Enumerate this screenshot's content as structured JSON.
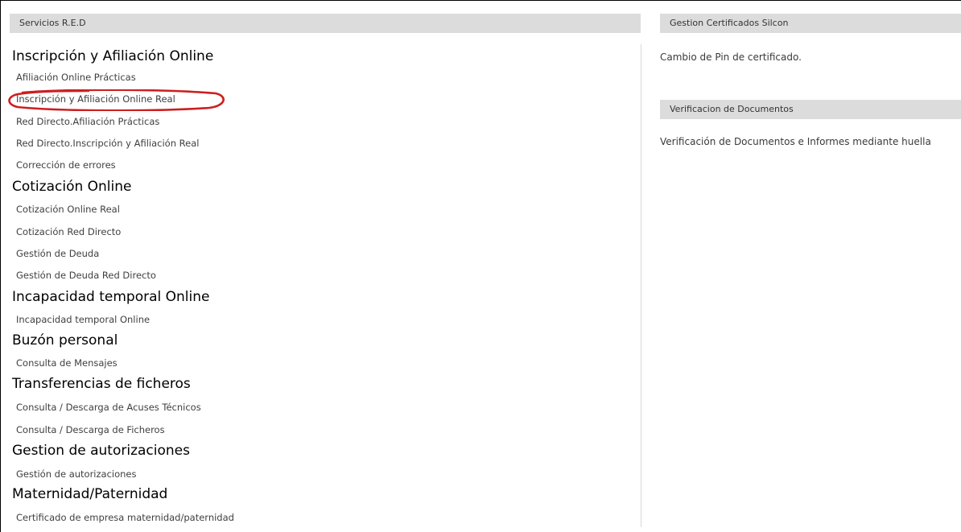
{
  "left_panel": {
    "header": "Servicios R.E.D",
    "sections": [
      {
        "title": "Inscripción y Afiliación Online",
        "links": [
          "Afiliación Online Prácticas",
          "Inscripción y Afiliación Online Real",
          "Red Directo.Afiliación Prácticas",
          "Red Directo.Inscripción y Afiliación Real",
          "Corrección de errores"
        ]
      },
      {
        "title": "Cotización Online",
        "links": [
          "Cotización Online Real",
          "Cotización Red Directo",
          "Gestión de Deuda",
          "Gestión de Deuda Red Directo"
        ]
      },
      {
        "title": "Incapacidad temporal Online",
        "links": [
          "Incapacidad temporal Online"
        ]
      },
      {
        "title": "Buzón personal",
        "links": [
          "Consulta de Mensajes"
        ]
      },
      {
        "title": "Transferencias de ficheros",
        "links": [
          "Consulta / Descarga de Acuses Técnicos",
          "Consulta / Descarga de Ficheros"
        ]
      },
      {
        "title": "Gestion de autorizaciones",
        "links": [
          "Gestión de autorizaciones"
        ]
      },
      {
        "title": "Maternidad/Paternidad",
        "links": [
          "Certificado de empresa maternidad/paternidad"
        ]
      }
    ]
  },
  "right_panel": {
    "certificados": {
      "header": "Gestion Certificados Silcon",
      "link": "Cambio de Pin de certificado."
    },
    "verificacion": {
      "header": "Verificacion de Documentos",
      "link": "Verificación de Documentos e Informes mediante huella"
    }
  },
  "colors": {
    "header_bg": "#dcdcdc",
    "highlight_oval": "#cc1f1f"
  }
}
